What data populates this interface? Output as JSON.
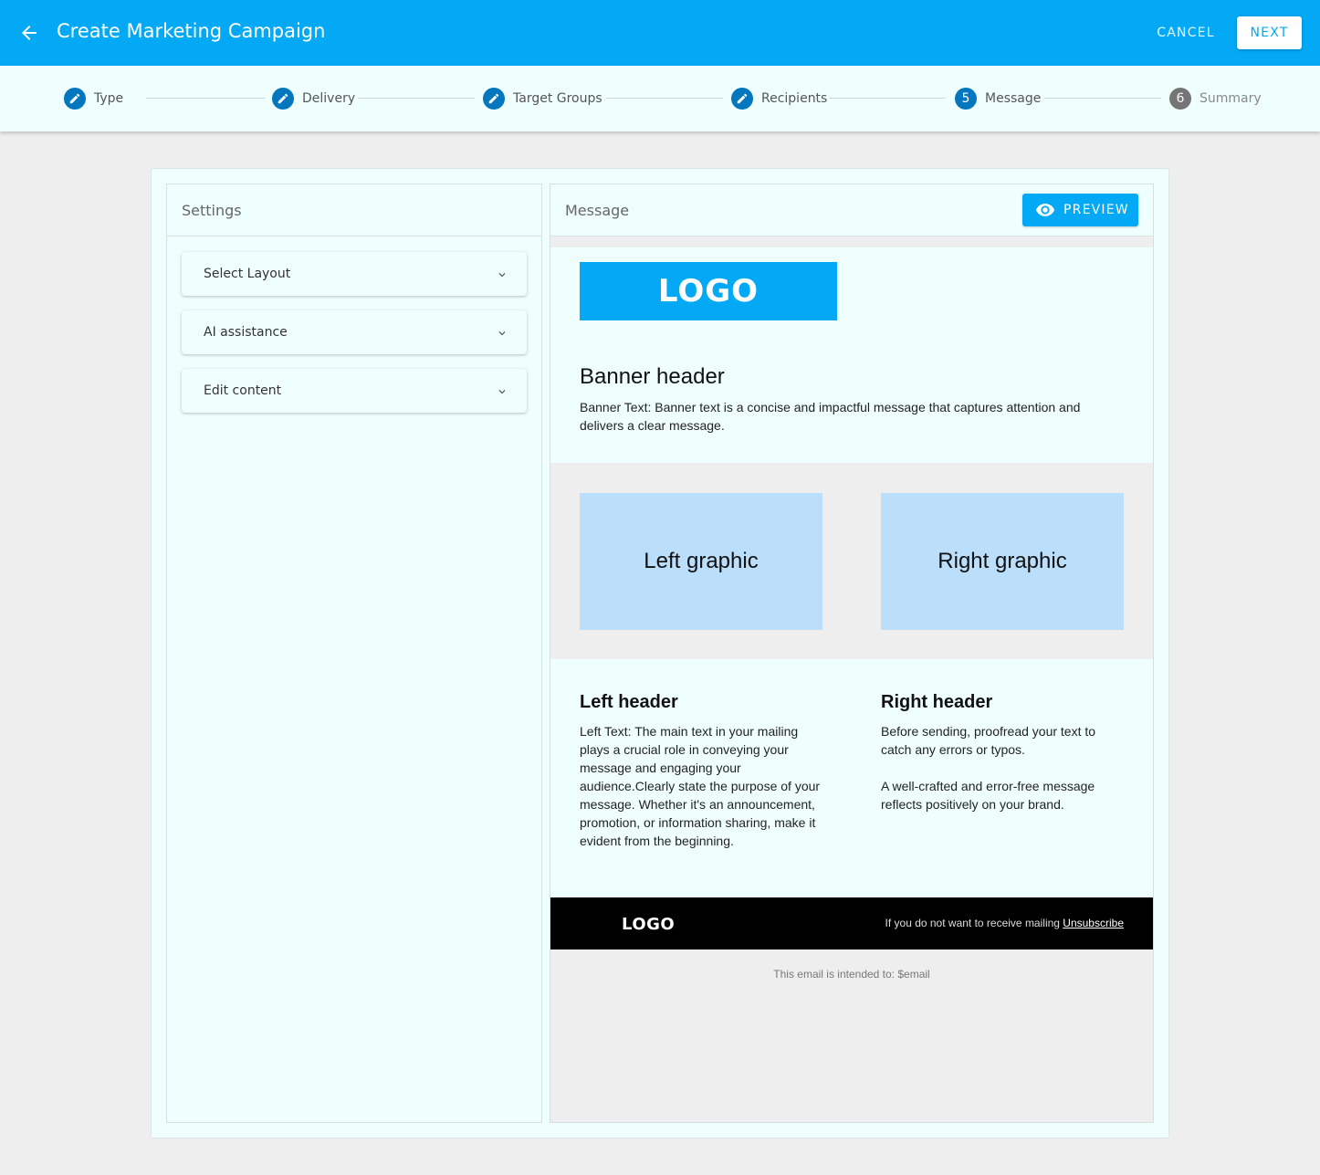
{
  "app": {
    "title": "Create Marketing Campaign",
    "cancel_label": "CANCEL",
    "next_label": "NEXT",
    "colors": {
      "primary": "#03a9f4",
      "step_done": "#0277bd",
      "step_pending": "#757575",
      "background": "#effffe"
    }
  },
  "stepper": {
    "steps": [
      {
        "label": "Type",
        "icon": "pencil-icon",
        "state": "done"
      },
      {
        "label": "Delivery",
        "icon": "pencil-icon",
        "state": "done"
      },
      {
        "label": "Target Groups",
        "icon": "pencil-icon",
        "state": "done"
      },
      {
        "label": "Recipients",
        "icon": "pencil-icon",
        "state": "done"
      },
      {
        "label": "Message",
        "number": "5",
        "state": "active"
      },
      {
        "label": "Summary",
        "number": "6",
        "state": "pending"
      }
    ]
  },
  "settings": {
    "title": "Settings",
    "sections": [
      {
        "label": "Select Layout"
      },
      {
        "label": "AI assistance"
      },
      {
        "label": "Edit content"
      }
    ]
  },
  "message": {
    "title": "Message",
    "preview_label": "PREVIEW",
    "email": {
      "logo": "LOGO",
      "banner_header": "Banner header",
      "banner_text": "Banner Text: Banner text is a concise and impactful message that captures attention and delivers a clear message.",
      "left_graphic": "Left graphic",
      "right_graphic": "Right graphic",
      "left_header": "Left header",
      "left_text": "Left Text: The main text in your mailing plays a crucial role in conveying your message and engaging your audience.Clearly state the purpose of your message. Whether it's an announcement, promotion, or information sharing, make it evident from the beginning.",
      "right_header": "Right header",
      "right_text_1": "Before sending, proofread your text to catch any errors or typos.",
      "right_text_2": "A well-crafted and error-free message reflects positively on your brand.",
      "footer_logo": "LOGO",
      "footer_text": "If you do not want to receive mailing",
      "unsubscribe_label": "Unsubscribe",
      "intended_text": "This email is intended to: $email"
    }
  }
}
